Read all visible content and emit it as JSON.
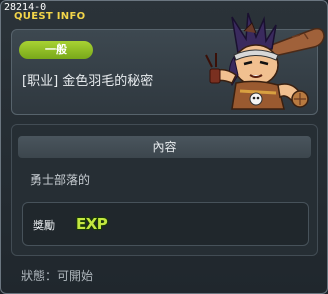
{
  "window": {
    "quest_id": "28214-0",
    "title": "QUEST INFO"
  },
  "quest": {
    "category": "一般",
    "name": "[职业] 金色羽毛的秘密"
  },
  "content": {
    "header": "內容",
    "text": "勇士部落的",
    "reward_label": "獎勵",
    "reward_icon": "exp-icon"
  },
  "status": {
    "text": "狀態：可開始"
  },
  "colors": {
    "title": "#f2d54a",
    "category_pill": "#8ebd22",
    "background": "#222a30"
  }
}
